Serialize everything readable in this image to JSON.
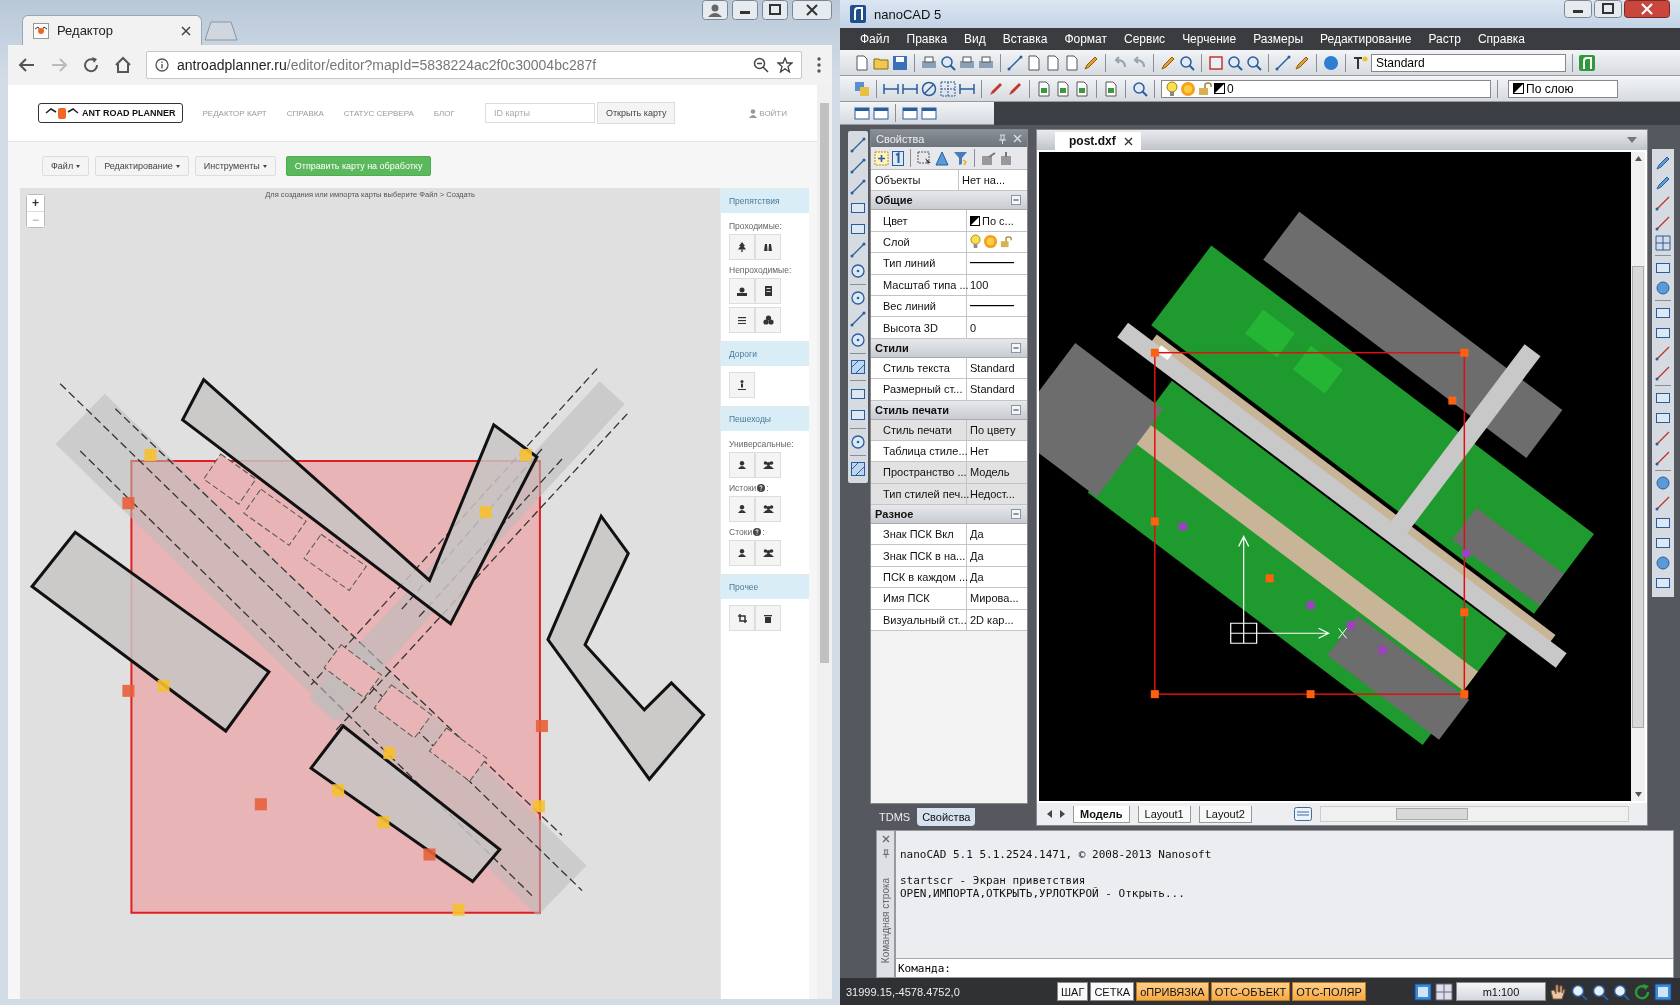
{
  "browser": {
    "tab_title": "Редактор",
    "url_host": "antroadplanner.ru",
    "url_path": "/editor/editor?mapId=5838224ac2f0c30004bc287f"
  },
  "site": {
    "logo": "ANT ROAD PLANNER",
    "nav": [
      "РЕДАКТОР КАРТ",
      "СПРАВКА",
      "СТАТУС СЕРВЕРА",
      "БЛОГ"
    ],
    "map_id_placeholder": "ID карты",
    "open_button": "Открыть карту",
    "login": "ВОЙТИ"
  },
  "editor_toolbar": {
    "menus": [
      "Файл",
      "Редактирование",
      "Инструменты"
    ],
    "send_button": "Отправить карту на обработку"
  },
  "map": {
    "hint": "Для создания или импорта карты выберите Файл > Создать",
    "zoom_in": "+",
    "zoom_out": "−"
  },
  "tool_panel": [
    {
      "title": "Препятствия",
      "groups": [
        {
          "label": "Проходимые:",
          "help": false,
          "rows": [
            [
              {
                "kind": "tree"
              },
              {
                "kind": "binoculars"
              }
            ]
          ]
        },
        {
          "label": "Непроходимые:",
          "help": false,
          "rows": [
            [
              {
                "kind": "bust"
              },
              {
                "kind": "building"
              }
            ],
            [
              {
                "kind": "bars"
              },
              {
                "kind": "cubes"
              }
            ]
          ]
        }
      ]
    },
    {
      "title": "Дороги",
      "groups": [
        {
          "help": false,
          "rows": [
            [
              {
                "kind": "road"
              }
            ]
          ]
        }
      ]
    },
    {
      "title": "Пешеходы",
      "groups": [
        {
          "label": "Универсальные:",
          "help": false,
          "rows": [
            [
              {
                "kind": "user"
              },
              {
                "kind": "users"
              }
            ]
          ]
        },
        {
          "label": "Истоки",
          "help": true,
          "suffix": ":",
          "rows": [
            [
              {
                "kind": "user"
              },
              {
                "kind": "users"
              }
            ]
          ]
        },
        {
          "label": "Стоки",
          "help": true,
          "suffix": ":",
          "rows": [
            [
              {
                "kind": "user"
              },
              {
                "kind": "users"
              }
            ]
          ]
        }
      ]
    },
    {
      "title": "Прочее",
      "groups": [
        {
          "help": false,
          "rows": [
            [
              {
                "kind": "crop"
              },
              {
                "kind": "trash"
              }
            ]
          ]
        }
      ]
    }
  ],
  "cad": {
    "title": "nanoCAD 5",
    "menu": [
      "Файл",
      "Правка",
      "Вид",
      "Вставка",
      "Формат",
      "Сервис",
      "Черчение",
      "Размеры",
      "Редактирование",
      "Растр",
      "Справка"
    ],
    "text_style": "Standard",
    "layer": "0",
    "linetype": "По слою"
  },
  "properties": {
    "title": "Свойства",
    "objects": {
      "name": "Объекты",
      "value": "Нет на..."
    },
    "sections": [
      {
        "title": "Общие",
        "rows": [
          {
            "kind": "color",
            "name": "Цвет",
            "value": "По с...",
            "disabled": false
          },
          {
            "kind": "layer",
            "name": "Слой",
            "disabled": false
          },
          {
            "kind": "line",
            "name": "Тип линий",
            "disabled": false
          },
          {
            "kind": "text",
            "name": "Масштаб типа ...",
            "value": "100",
            "disabled": false
          },
          {
            "kind": "line",
            "name": "Вес линий",
            "disabled": false
          },
          {
            "kind": "text",
            "name": "Высота 3D",
            "value": "0",
            "disabled": false
          }
        ]
      },
      {
        "title": "Стили",
        "rows": [
          {
            "kind": "text",
            "name": "Стиль текста",
            "value": "Standard",
            "disabled": false
          },
          {
            "kind": "text",
            "name": "Размерный ст...",
            "value": "Standard",
            "disabled": false
          }
        ]
      },
      {
        "title": "Стиль печати",
        "rows": [
          {
            "kind": "text",
            "name": "Стиль печати",
            "value": "По цвету",
            "disabled": true
          },
          {
            "kind": "text",
            "name": "Таблица стиле...",
            "value": "Нет",
            "disabled": false
          },
          {
            "kind": "text",
            "name": "Пространство ...",
            "value": "Модель",
            "disabled": true
          },
          {
            "kind": "text",
            "name": "Тип стилей печ...",
            "value": "Недост...",
            "disabled": true
          }
        ]
      },
      {
        "title": "Разное",
        "rows": [
          {
            "kind": "text",
            "name": "Знак ПСК Вкл",
            "value": "Да",
            "disabled": false
          },
          {
            "kind": "text",
            "name": "Знак ПСК в на...",
            "value": "Да",
            "disabled": false
          },
          {
            "kind": "text",
            "name": "ПСК в каждом ...",
            "value": "Да",
            "disabled": false
          },
          {
            "kind": "text",
            "name": "Имя ПСК",
            "value": "Мирова...",
            "disabled": false
          },
          {
            "kind": "text",
            "name": "Визуальный ст...",
            "value": "2D кар...",
            "disabled": false
          }
        ]
      }
    ]
  },
  "panel_tabs": [
    {
      "label": "TDMS",
      "selected": false
    },
    {
      "label": "Свойства",
      "selected": true
    }
  ],
  "document_tab": {
    "title": "post.dxf"
  },
  "layout_tabs": [
    {
      "label": "Модель",
      "selected": true
    },
    {
      "label": "Layout1",
      "selected": false
    },
    {
      "label": "Layout2",
      "selected": false
    }
  ],
  "command": {
    "side_title": "Командная строка",
    "blocks": [
      [
        "nanoCAD 5.1 5.1.2524.1471, © 2008-2013 Nanosoft"
      ],
      [
        "startscr - Экран приветствия",
        "OPEN,ИМПОРТА,ОТКРЫТЬ,УРЛОТКРОЙ - Открыть..."
      ]
    ],
    "prompt": "Команда:"
  },
  "status": {
    "coords": "31999.15,-4578.4752,0",
    "toggles": [
      {
        "label": "ШАГ",
        "on": false
      },
      {
        "label": "СЕТКА",
        "on": false
      },
      {
        "label": "оПРИВЯЗКА",
        "on": true
      },
      {
        "label": "ОТС-ОБЪЕКТ",
        "on": true
      },
      {
        "label": "ОТС-ПОЛЯР",
        "on": true
      }
    ],
    "scale": "m1:100"
  }
}
